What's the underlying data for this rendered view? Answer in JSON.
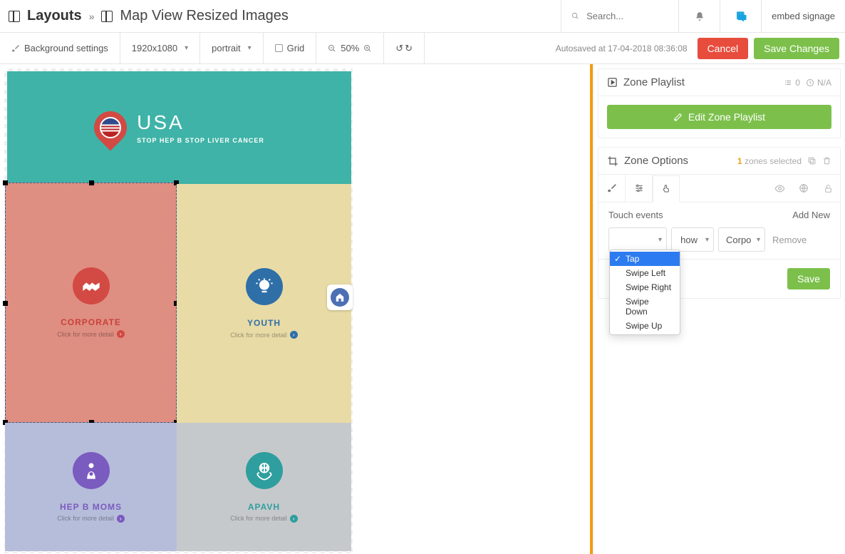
{
  "header": {
    "breadcrumb_root": "Layouts",
    "breadcrumb_page": "Map View Resized Images",
    "search_placeholder": "Search...",
    "brand": "embed signage"
  },
  "toolbar": {
    "background_settings": "Background settings",
    "resolution": "1920x1080",
    "orientation": "portrait",
    "grid_label": "Grid",
    "zoom_label": "50%",
    "autosave": "Autosaved at 17-04-2018 08:36:08",
    "cancel": "Cancel",
    "save_changes": "Save Changes"
  },
  "canvas": {
    "top_zone": {
      "title": "USA",
      "subtitle": "STOP HEP B STOP LIVER CANCER"
    },
    "click_detail": "Click for more detail",
    "tiles": {
      "corporate": "CORPORATE",
      "youth": "YOUTH",
      "hepbmoms": "HEP B MOMS",
      "apavh": "APAVH"
    }
  },
  "side": {
    "zone_playlist": {
      "title": "Zone Playlist",
      "count": "0",
      "duration": "N/A",
      "edit_button": "Edit Zone Playlist"
    },
    "zone_options": {
      "title": "Zone Options",
      "selected_count": "1",
      "selected_label": "zones selected"
    },
    "touch": {
      "section_label": "Touch events",
      "add_new": "Add New",
      "action_value": "how",
      "target_value": "Corpo",
      "remove": "Remove",
      "save": "Save",
      "options": [
        "Tap",
        "Swipe Left",
        "Swipe Right",
        "Swipe Down",
        "Swipe Up"
      ]
    }
  }
}
